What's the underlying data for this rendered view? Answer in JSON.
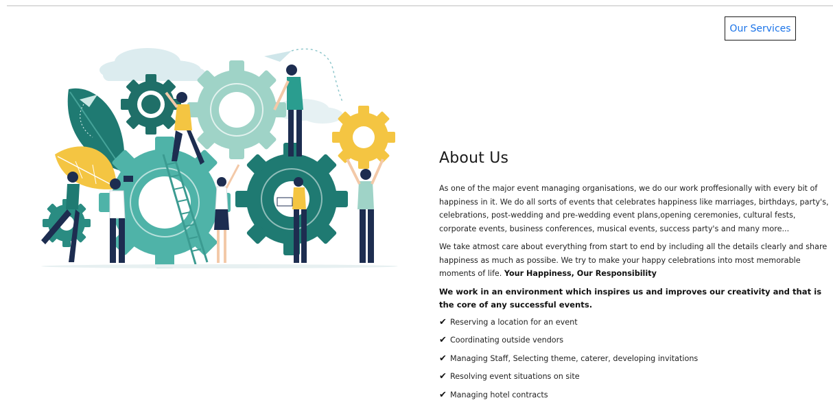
{
  "header": {
    "services_button": "Our Services"
  },
  "about": {
    "title": "About Us",
    "paragraph1": "As one of the major event managing organisations, we do our work proffesionally with every bit of happiness in it. We do all sorts of events that celebrates happiness like marriages, birthdays, party's, celebrations, post-wedding and pre-wedding event plans,opening ceremonies, cultural fests, corporate events, business conferences, musical events, success party's and many more...",
    "paragraph2": "We take atmost care about everything from start to end by including all the details clearly and share happiness as much as possibe. We try to make your happy celebrations into most memorable moments of life.",
    "tagline": "Your Happiness, Our Responsibility",
    "paragraph3": "We work in an environment which inspires us and improves our creativity and that is the core of any successful events.",
    "checklist": [
      "Reserving a location for an event",
      "Coordinating outside vendors",
      "Managing Staff, Selecting theme, caterer, developing invitations",
      "Resolving event situations on site",
      "Managing hotel contracts"
    ],
    "check_glyph": "✔"
  },
  "colors": {
    "teal_dark": "#1f7a72",
    "teal": "#2a9d8f",
    "teal_light": "#9fd3c7",
    "yellow": "#f4c542",
    "navy": "#1d2d50",
    "link_blue": "#1a73e8"
  }
}
